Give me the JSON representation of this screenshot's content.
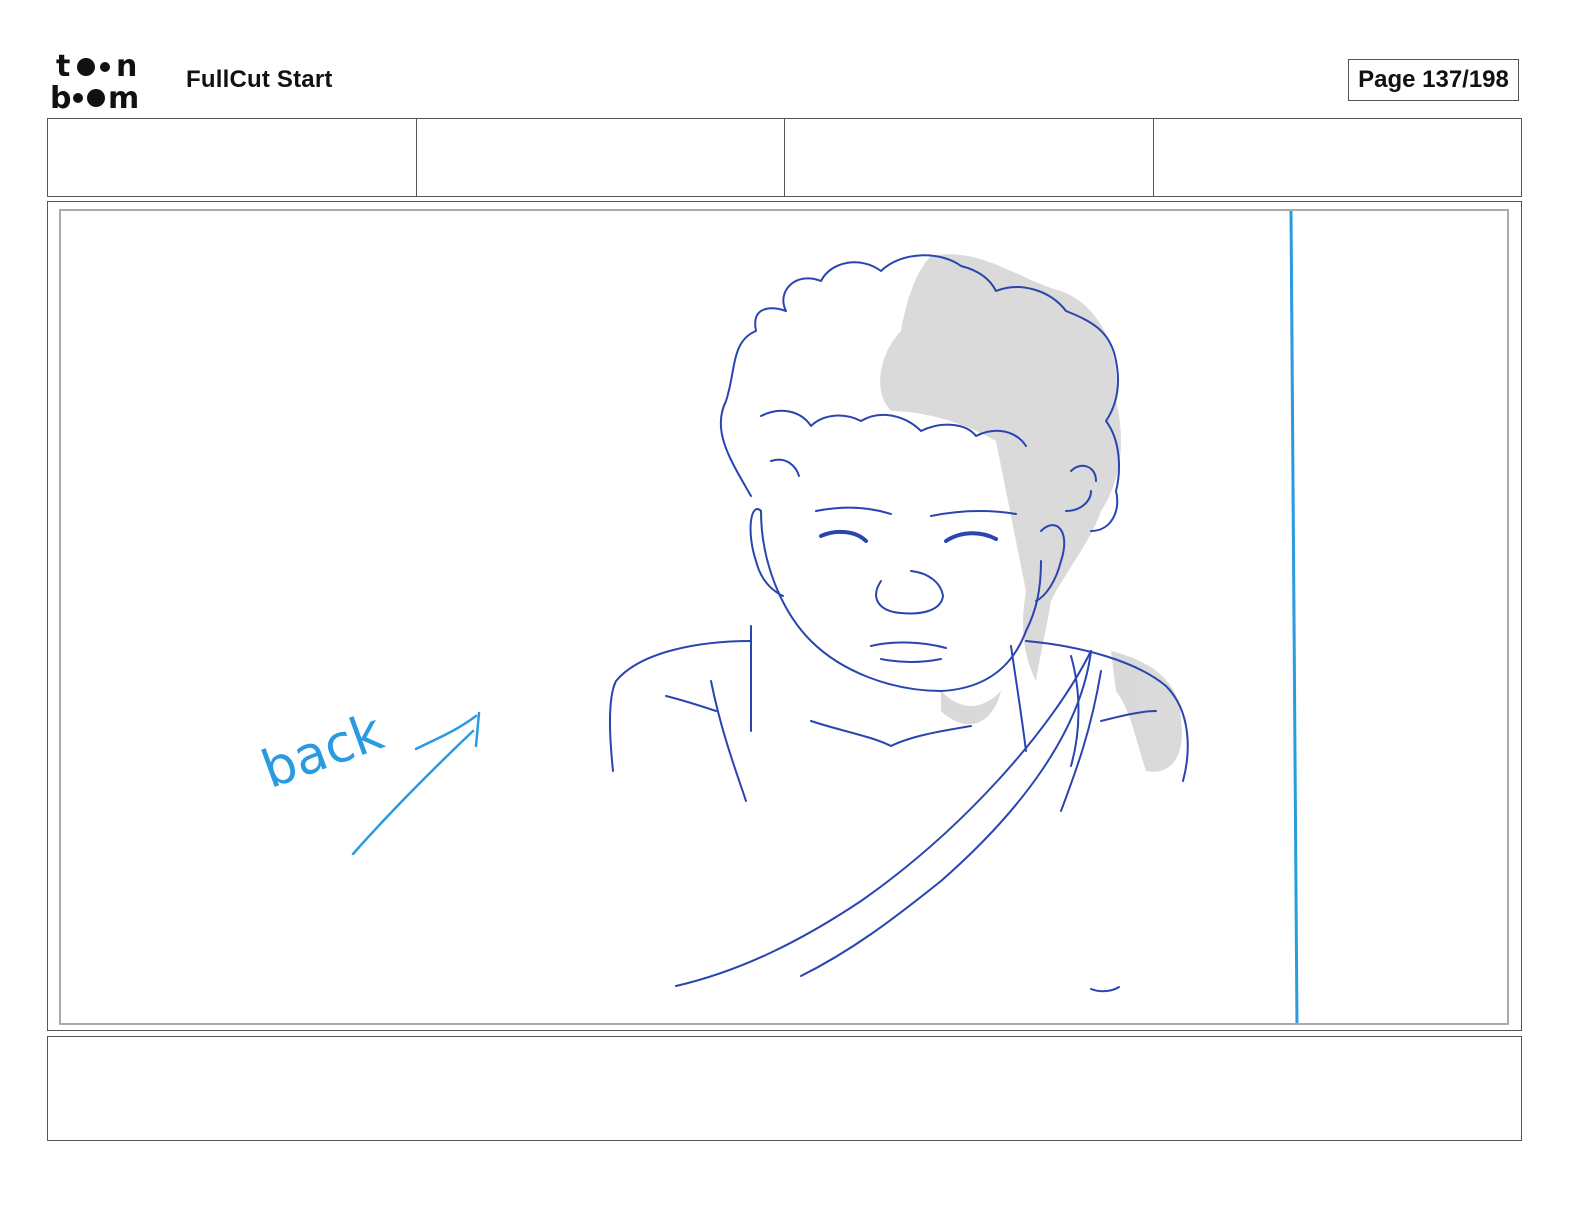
{
  "header": {
    "logo": {
      "icon": "toonboom-logo",
      "top_text": "toon",
      "bottom_text": "boom"
    },
    "project_title": "FullCut Start",
    "page_counter": "Page 137/198"
  },
  "info_cells": [
    "",
    "",
    "",
    ""
  ],
  "panel": {
    "annotation_text": "back",
    "annotation_icon": "arrow-up-right-icon",
    "sketch_color": "#2a45b0",
    "annotation_color": "#2a9be0",
    "shadow_color": "#cfcfcf"
  },
  "caption": ""
}
